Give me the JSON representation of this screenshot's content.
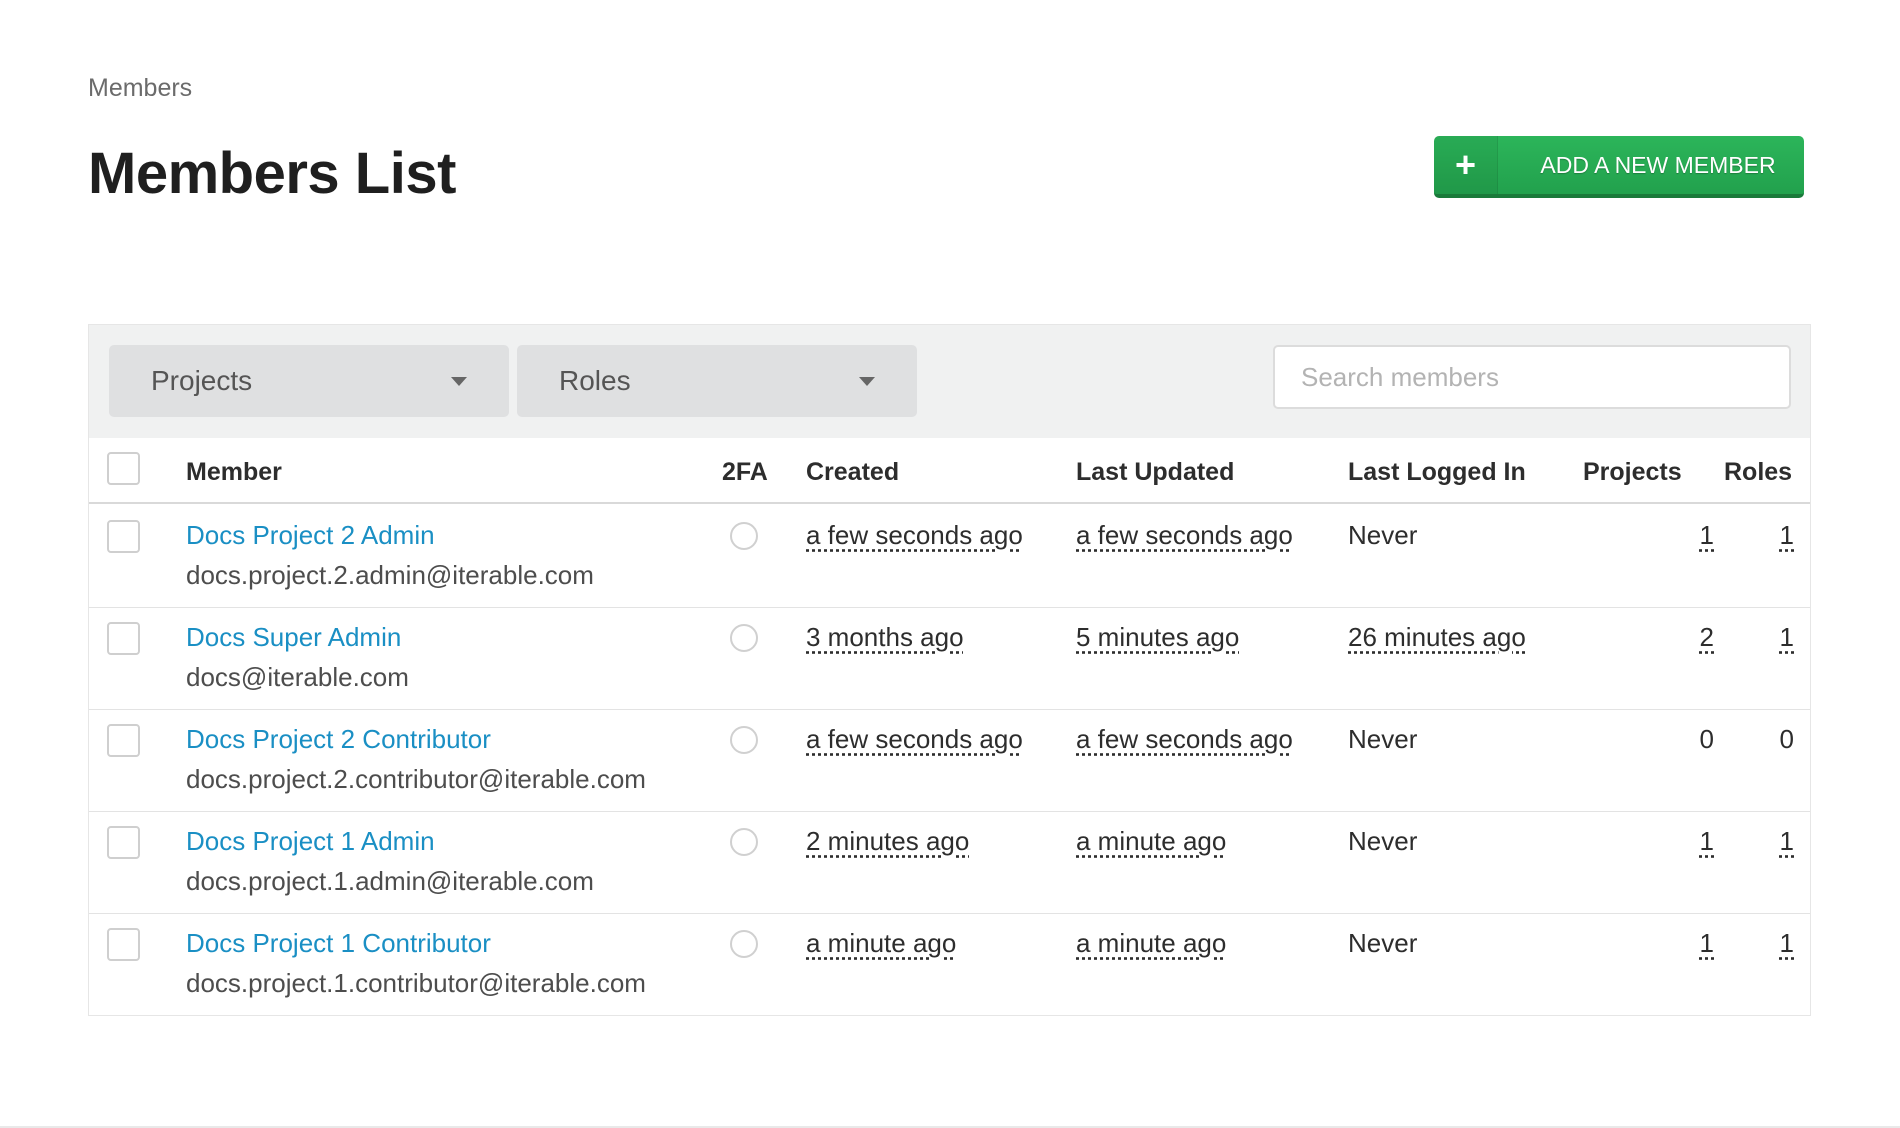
{
  "breadcrumb": "Members",
  "page_title": "Members List",
  "add_button": {
    "icon": "plus-icon",
    "label": "ADD A NEW MEMBER",
    "color": "#27ae55"
  },
  "filters": {
    "projects_label": "Projects",
    "roles_label": "Roles",
    "search_placeholder": "Search members"
  },
  "columns": {
    "member": "Member",
    "twofa": "2FA",
    "created": "Created",
    "last_updated": "Last Updated",
    "last_logged_in": "Last Logged In",
    "projects": "Projects",
    "roles": "Roles"
  },
  "link_color": "#1a8fc4",
  "members": [
    {
      "name": "Docs Project 2 Admin",
      "email": "docs.project.2.admin@iterable.com",
      "created": "a few seconds ago",
      "last_updated": "a few seconds ago",
      "last_logged_in": "Never",
      "projects": "1",
      "roles": "1"
    },
    {
      "name": "Docs Super Admin",
      "email": "docs@iterable.com",
      "created": "3 months ago",
      "last_updated": "5 minutes ago",
      "last_logged_in": "26 minutes ago",
      "projects": "2",
      "roles": "1"
    },
    {
      "name": "Docs Project 2 Contributor",
      "email": "docs.project.2.contributor@iterable.com",
      "created": "a few seconds ago",
      "last_updated": "a few seconds ago",
      "last_logged_in": "Never",
      "projects": "0",
      "roles": "0"
    },
    {
      "name": "Docs Project 1 Admin",
      "email": "docs.project.1.admin@iterable.com",
      "created": "2 minutes ago",
      "last_updated": "a minute ago",
      "last_logged_in": "Never",
      "projects": "1",
      "roles": "1"
    },
    {
      "name": "Docs Project 1 Contributor",
      "email": "docs.project.1.contributor@iterable.com",
      "created": "a minute ago",
      "last_updated": "a minute ago",
      "last_logged_in": "Never",
      "projects": "1",
      "roles": "1"
    }
  ]
}
